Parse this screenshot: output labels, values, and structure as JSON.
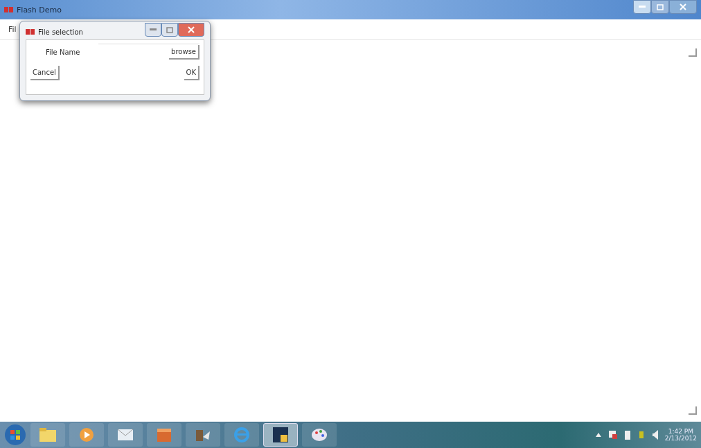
{
  "window": {
    "title": "Flash Demo"
  },
  "menu": [
    {
      "label": "Fil"
    }
  ],
  "dialog": {
    "title": "File selection",
    "field_label": "File Name",
    "browse_button": "browse",
    "cancel_button": "Cancel",
    "ok_button": "OK"
  },
  "taskbar": {
    "apps": [
      {
        "kind": "folder",
        "selected": false
      },
      {
        "kind": "media",
        "selected": false
      },
      {
        "kind": "mail",
        "selected": false
      },
      {
        "kind": "box",
        "selected": false
      },
      {
        "kind": "tool",
        "selected": false
      },
      {
        "kind": "browser",
        "selected": false
      },
      {
        "kind": "flash",
        "selected": true
      },
      {
        "kind": "paint",
        "selected": false
      }
    ],
    "clock": {
      "time": "1:42 PM",
      "date": "2/13/2012"
    }
  }
}
